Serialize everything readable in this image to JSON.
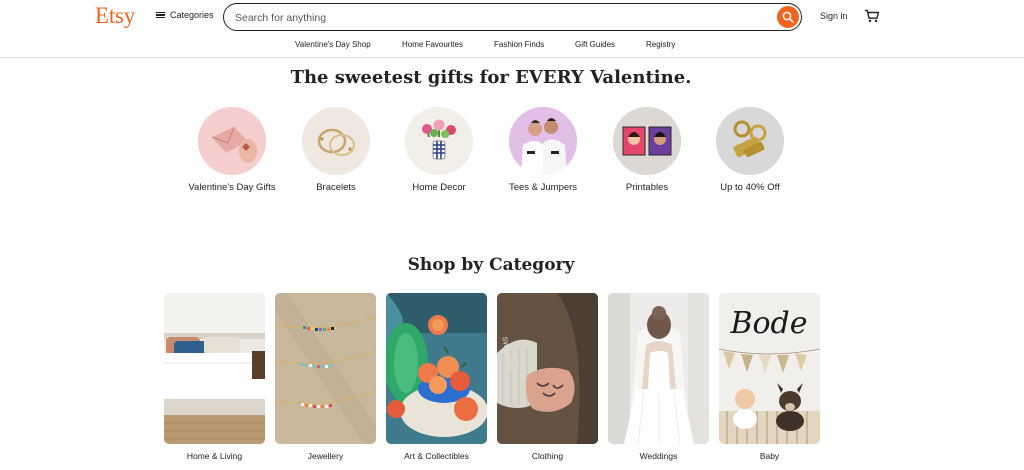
{
  "header": {
    "logo": "Etsy",
    "categories_label": "Categories",
    "search_placeholder": "Search for anything",
    "signin_label": "Sign in"
  },
  "nav": {
    "items": [
      {
        "label": "Valentine's Day Shop"
      },
      {
        "label": "Home Favourites"
      },
      {
        "label": "Fashion Finds"
      },
      {
        "label": "Gift Guides"
      },
      {
        "label": "Registry"
      }
    ]
  },
  "hero": {
    "title": "The sweetest gifts for EVERY Valentine.",
    "circles": [
      {
        "label": "Valentine's Day Gifts",
        "icon": "valentines-gift-image"
      },
      {
        "label": "Bracelets",
        "icon": "bracelets-image"
      },
      {
        "label": "Home Decor",
        "icon": "home-decor-image"
      },
      {
        "label": "Tees & Jumpers",
        "icon": "tees-jumpers-image"
      },
      {
        "label": "Printables",
        "icon": "printables-image"
      },
      {
        "label": "Up to 40% Off",
        "icon": "discount-image"
      }
    ]
  },
  "categories": {
    "title": "Shop by Category",
    "items": [
      {
        "label": "Home & Living"
      },
      {
        "label": "Jewellery"
      },
      {
        "label": "Art & Collectibles"
      },
      {
        "label": "Clothing"
      },
      {
        "label": "Weddings"
      },
      {
        "label": "Baby"
      }
    ]
  },
  "art_text": {
    "baby_sign": "Bode"
  },
  "colors": {
    "brand": "#f1641e",
    "text": "#222222",
    "divider": "#e2e2e2"
  }
}
